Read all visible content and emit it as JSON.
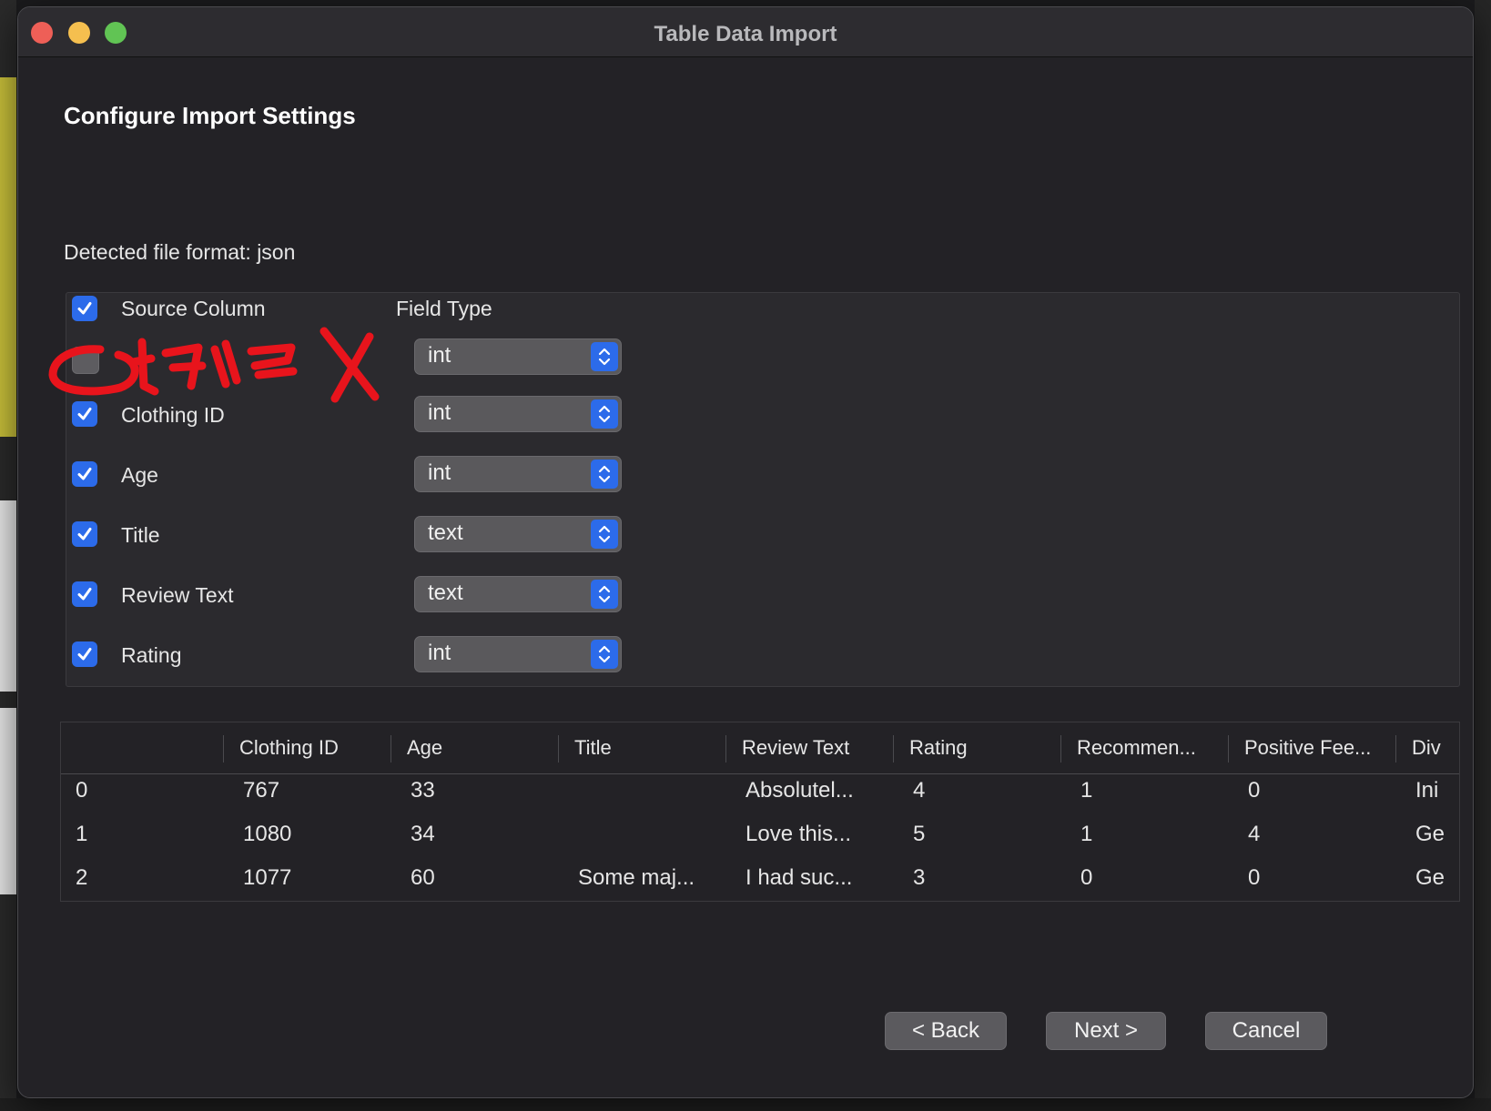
{
  "window": {
    "title": "Table Data Import"
  },
  "page": {
    "heading": "Configure Import Settings",
    "detected_format": "Detected file format: json"
  },
  "fields": {
    "header_source": "Source Column",
    "header_type": "Field Type",
    "rows": [
      {
        "checked": false,
        "label": "",
        "type": "int"
      },
      {
        "checked": true,
        "label": "Clothing ID",
        "type": "int"
      },
      {
        "checked": true,
        "label": "Age",
        "type": "int"
      },
      {
        "checked": true,
        "label": "Title",
        "type": "text"
      },
      {
        "checked": true,
        "label": "Review Text",
        "type": "text"
      },
      {
        "checked": true,
        "label": "Rating",
        "type": "int"
      }
    ]
  },
  "preview": {
    "columns": [
      "",
      "Clothing ID",
      "Age",
      "Title",
      "Review Text",
      "Rating",
      "Recommen...",
      "Positive Fee...",
      "Div"
    ],
    "rows": [
      [
        "0",
        "767",
        "33",
        "",
        "Absolutel...",
        "4",
        "1",
        "0",
        "Ini"
      ],
      [
        "1",
        "1080",
        "34",
        "",
        "Love this...",
        "5",
        "1",
        "4",
        "Ge"
      ],
      [
        "2",
        "1077",
        "60",
        "Some maj...",
        "I had suc...",
        "3",
        "0",
        "0",
        "Ge"
      ]
    ]
  },
  "buttons": {
    "back": "< Back",
    "next": "Next >",
    "cancel": "Cancel"
  },
  "annotation": {
    "color": "#e8141c",
    "description_icon": "red-handwritten-annotation-icon"
  },
  "colors": {
    "accent": "#2c6bea",
    "window_bg": "#232226"
  }
}
